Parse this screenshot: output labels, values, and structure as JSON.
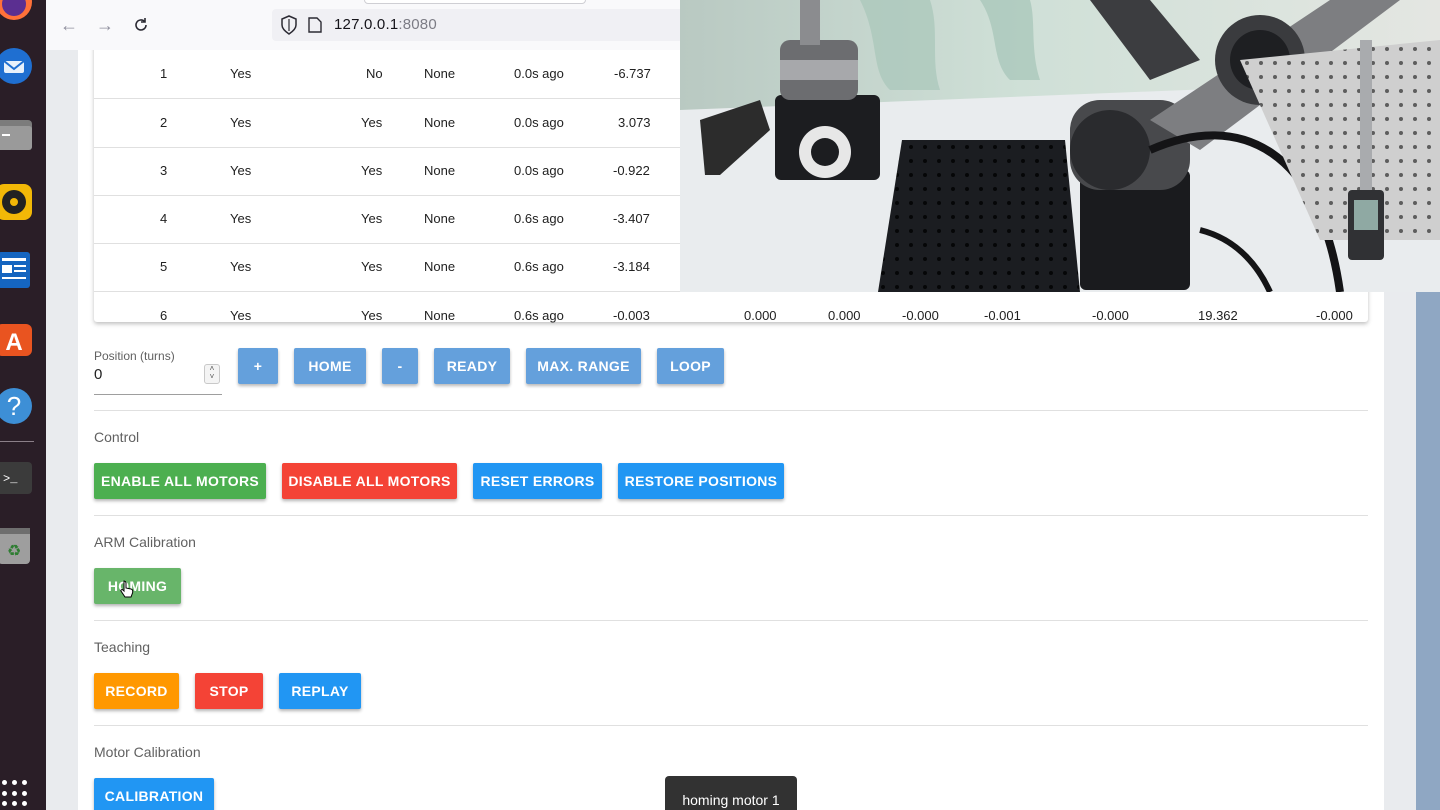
{
  "browser": {
    "url_host": "127.0.0.1",
    "url_port": ":8080"
  },
  "dock": {
    "icons": [
      "firefox-icon",
      "thunderbird-icon",
      "files-icon",
      "rhythmbox-icon",
      "writer-icon",
      "app-center-icon",
      "help-icon",
      "terminal-icon",
      "trash-icon",
      "show-apps-icon"
    ]
  },
  "table": {
    "rows": [
      {
        "id": "1",
        "a": "Yes",
        "b": "No",
        "err": "None",
        "time": "0.0s ago",
        "v1": "-6.737"
      },
      {
        "id": "2",
        "a": "Yes",
        "b": "Yes",
        "err": "None",
        "time": "0.0s ago",
        "v1": "3.073"
      },
      {
        "id": "3",
        "a": "Yes",
        "b": "Yes",
        "err": "None",
        "time": "0.0s ago",
        "v1": "-0.922"
      },
      {
        "id": "4",
        "a": "Yes",
        "b": "Yes",
        "err": "None",
        "time": "0.6s ago",
        "v1": "-3.407"
      },
      {
        "id": "5",
        "a": "Yes",
        "b": "Yes",
        "err": "None",
        "time": "0.6s ago",
        "v1": "-3.184"
      },
      {
        "id": "6",
        "a": "Yes",
        "b": "Yes",
        "err": "None",
        "time": "0.6s ago",
        "v1": "-0.003",
        "v2": "0.000",
        "v3": "0.000",
        "v4": "-0.000",
        "v5": "-0.001",
        "v6": "-0.000",
        "v7": "19.362",
        "v8": "-0.000"
      }
    ]
  },
  "position": {
    "label": "Position (turns)",
    "value": "0",
    "buttons": [
      "+",
      "HOME",
      "-",
      "READY",
      "MAX. RANGE",
      "LOOP"
    ]
  },
  "control": {
    "label": "Control",
    "enable": "ENABLE ALL MOTORS",
    "disable": "DISABLE ALL MOTORS",
    "reset": "RESET ERRORS",
    "restore": "RESTORE POSITIONS"
  },
  "arm": {
    "label": "ARM Calibration",
    "homing": "HOMING"
  },
  "teaching": {
    "label": "Teaching",
    "record": "RECORD",
    "stop": "STOP",
    "replay": "REPLAY"
  },
  "motor_cal": {
    "label": "Motor Calibration",
    "calibration": "CALIBRATION"
  },
  "toast": "homing motor 1",
  "colors": {
    "green": "#4caf50",
    "red": "#f44336",
    "blue": "#2196f3",
    "orange": "#ff9800",
    "position_buttons": "#5c9bdb"
  }
}
